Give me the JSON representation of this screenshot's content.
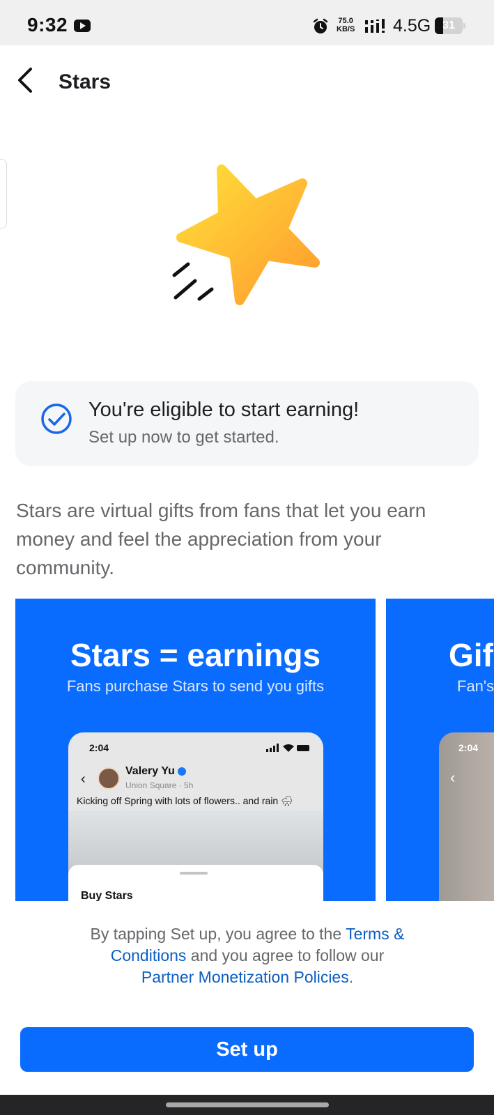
{
  "status_bar": {
    "time": "9:32",
    "net_speed_value": "75.0",
    "net_speed_unit": "KB/S",
    "network_type": "4.5G",
    "battery_level": "31",
    "battery_fraction": 0.31,
    "icons": [
      "youtube-icon",
      "alarm-icon",
      "signal-icon"
    ]
  },
  "header": {
    "title": "Stars",
    "back_icon": "chevron-left-icon"
  },
  "hero": {
    "icon": "star-icon"
  },
  "eligibility": {
    "icon": "check-circle-icon",
    "title": "You're eligible to start earning!",
    "subtitle": "Set up now to get started."
  },
  "description": "Stars are virtual gifts from fans that let you earn money and feel the appreciation from your community.",
  "carousel": {
    "slides": [
      {
        "title": "Stars = earnings",
        "subtitle": "Fans purchase Stars to send you gifts",
        "phone": {
          "time": "2:04",
          "user_name": "Valery Yu",
          "location": "Union Square · 5h",
          "caption": "Kicking off Spring with lots of flowers.. and rain 🌧",
          "sheet_label": "Buy Stars"
        }
      },
      {
        "title": "Gif",
        "subtitle": "Fan's",
        "phone": {
          "time": "2:04"
        }
      }
    ]
  },
  "legal": {
    "prefix": "By tapping Set up, you agree to the",
    "terms_link": "Terms & Conditions",
    "middle": "and you agree to follow our",
    "policies_link": "Partner Monetization Policies",
    "suffix": "."
  },
  "actions": {
    "setup_label": "Set up"
  },
  "colors": {
    "accent": "#0A6CFF",
    "link": "#0B5EC2",
    "card_bg": "#F5F6F8",
    "star_gradient": [
      "#FFE03A",
      "#FF9A2E"
    ]
  }
}
